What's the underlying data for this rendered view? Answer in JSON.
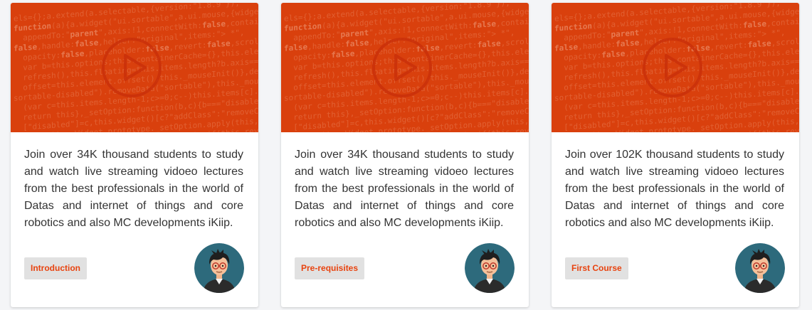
{
  "courses": [
    {
      "description": "Join over 34K thousand students to study and watch live streaming vidoeo lectures from the best professionals in the world of Datas and internet of things and core robotics and also MC developments iKiip.",
      "badge": "Introduction",
      "thumbnail_icon": "play-circle-icon",
      "avatar_icon": "instructor-avatar-icon"
    },
    {
      "description": "Join over 34K thousand students to study and watch live streaming vidoeo lectures from the best professionals in the world of Datas and internet of things and core robotics and also MC developments iKiip.",
      "badge": "Pre-requisites",
      "thumbnail_icon": "play-circle-icon",
      "avatar_icon": "instructor-avatar-icon"
    },
    {
      "description": "Join over 102K thousand students to study and watch live streaming vidoeo lectures from the best professionals in the world of Datas and internet of things and core robotics and also MC developments iKiip.",
      "badge": "First Course",
      "thumbnail_icon": "play-circle-icon",
      "avatar_icon": "instructor-avatar-icon"
    }
  ],
  "colors": {
    "thumbnail_bg": "#d9400d",
    "accent": "#e8430f",
    "badge_bg": "#e1e1e1",
    "avatar_bg": "#2d6a7c",
    "text": "#333333"
  }
}
